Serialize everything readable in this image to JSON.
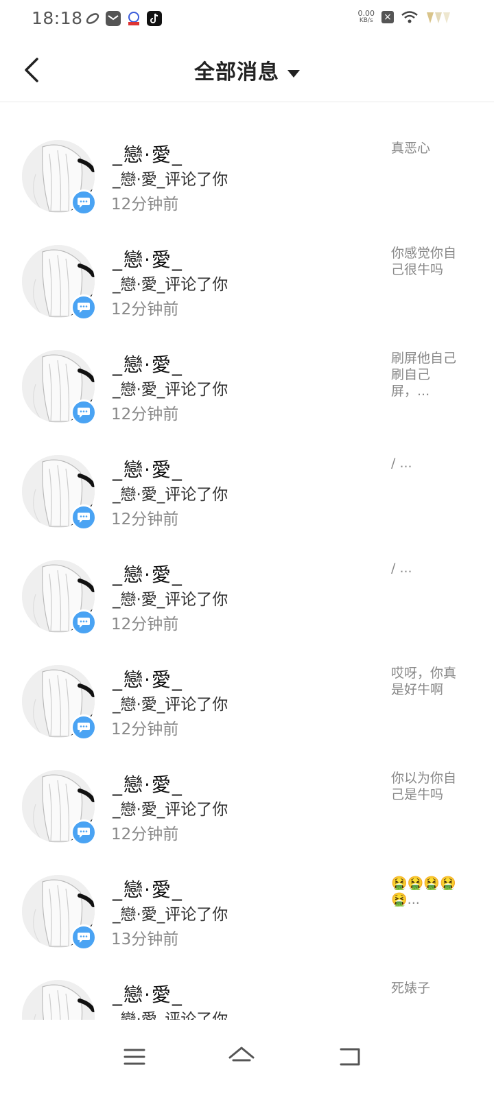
{
  "status_bar": {
    "time": "18:18",
    "net_speed_value": "0.00",
    "net_speed_unit": "KB/s"
  },
  "header": {
    "title": "全部消息",
    "back_icon": "chevron-left-icon",
    "dropdown_icon": "caret-down-icon"
  },
  "colors": {
    "badge": "#4aa3f3",
    "divider": "#e8e8e8",
    "secondary_text": "#888888"
  },
  "messages": [
    {
      "name": "_戀·愛_",
      "action": "_戀·愛_评论了你",
      "time": "12分钟前",
      "preview": "真恶心"
    },
    {
      "name": "_戀·愛_",
      "action": "_戀·愛_评论了你",
      "time": "12分钟前",
      "preview": "你感觉你自己很牛吗"
    },
    {
      "name": "_戀·愛_",
      "action": "_戀·愛_评论了你",
      "time": "12分钟前",
      "preview": "刷屏他自己刷自己屏，..."
    },
    {
      "name": "_戀·愛_",
      "action": "_戀·愛_评论了你",
      "time": "12分钟前",
      "preview": "/ ..."
    },
    {
      "name": "_戀·愛_",
      "action": "_戀·愛_评论了你",
      "time": "12分钟前",
      "preview": "/ ..."
    },
    {
      "name": "_戀·愛_",
      "action": "_戀·愛_评论了你",
      "time": "12分钟前",
      "preview": "哎呀，你真是好牛啊"
    },
    {
      "name": "_戀·愛_",
      "action": "_戀·愛_评论了你",
      "time": "12分钟前",
      "preview": "你以为你自己是牛吗"
    },
    {
      "name": "_戀·愛_",
      "action": "_戀·愛_评论了你",
      "time": "13分钟前",
      "preview": "🤮🤮🤮🤮🤮..."
    },
    {
      "name": "_戀·愛_",
      "action": "_戀·愛_评论了你",
      "time": "",
      "preview": "死婊子"
    }
  ],
  "nav_bar": {
    "menu_icon": "menu-icon",
    "home_icon": "home-icon",
    "back_icon": "back-icon"
  }
}
